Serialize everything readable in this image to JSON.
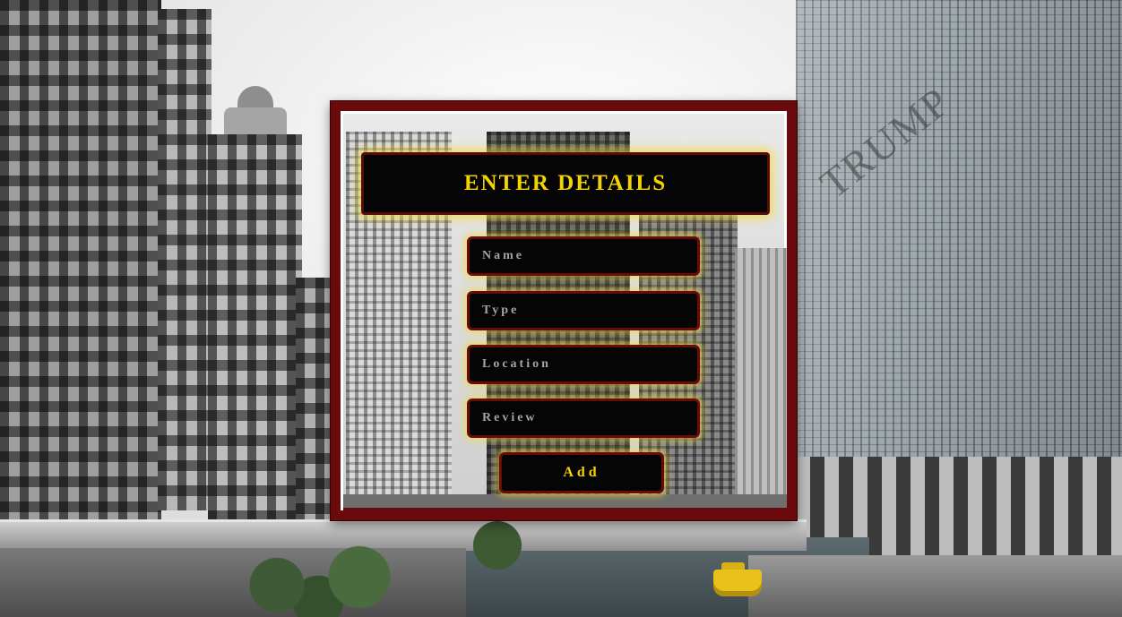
{
  "form": {
    "title": "ENTER DETAILS",
    "fields": {
      "name": {
        "placeholder": "Name",
        "value": ""
      },
      "type": {
        "placeholder": "Type",
        "value": ""
      },
      "location": {
        "placeholder": "Location",
        "value": ""
      },
      "review": {
        "placeholder": "Review",
        "value": ""
      }
    },
    "submit_label": "Add"
  },
  "background": {
    "sign_text": "TRUMP"
  },
  "colors": {
    "panel_border": "#6a0a0d",
    "accent_text": "#f4d400",
    "glow": "#f0dc3c",
    "field_bg": "#050505"
  }
}
